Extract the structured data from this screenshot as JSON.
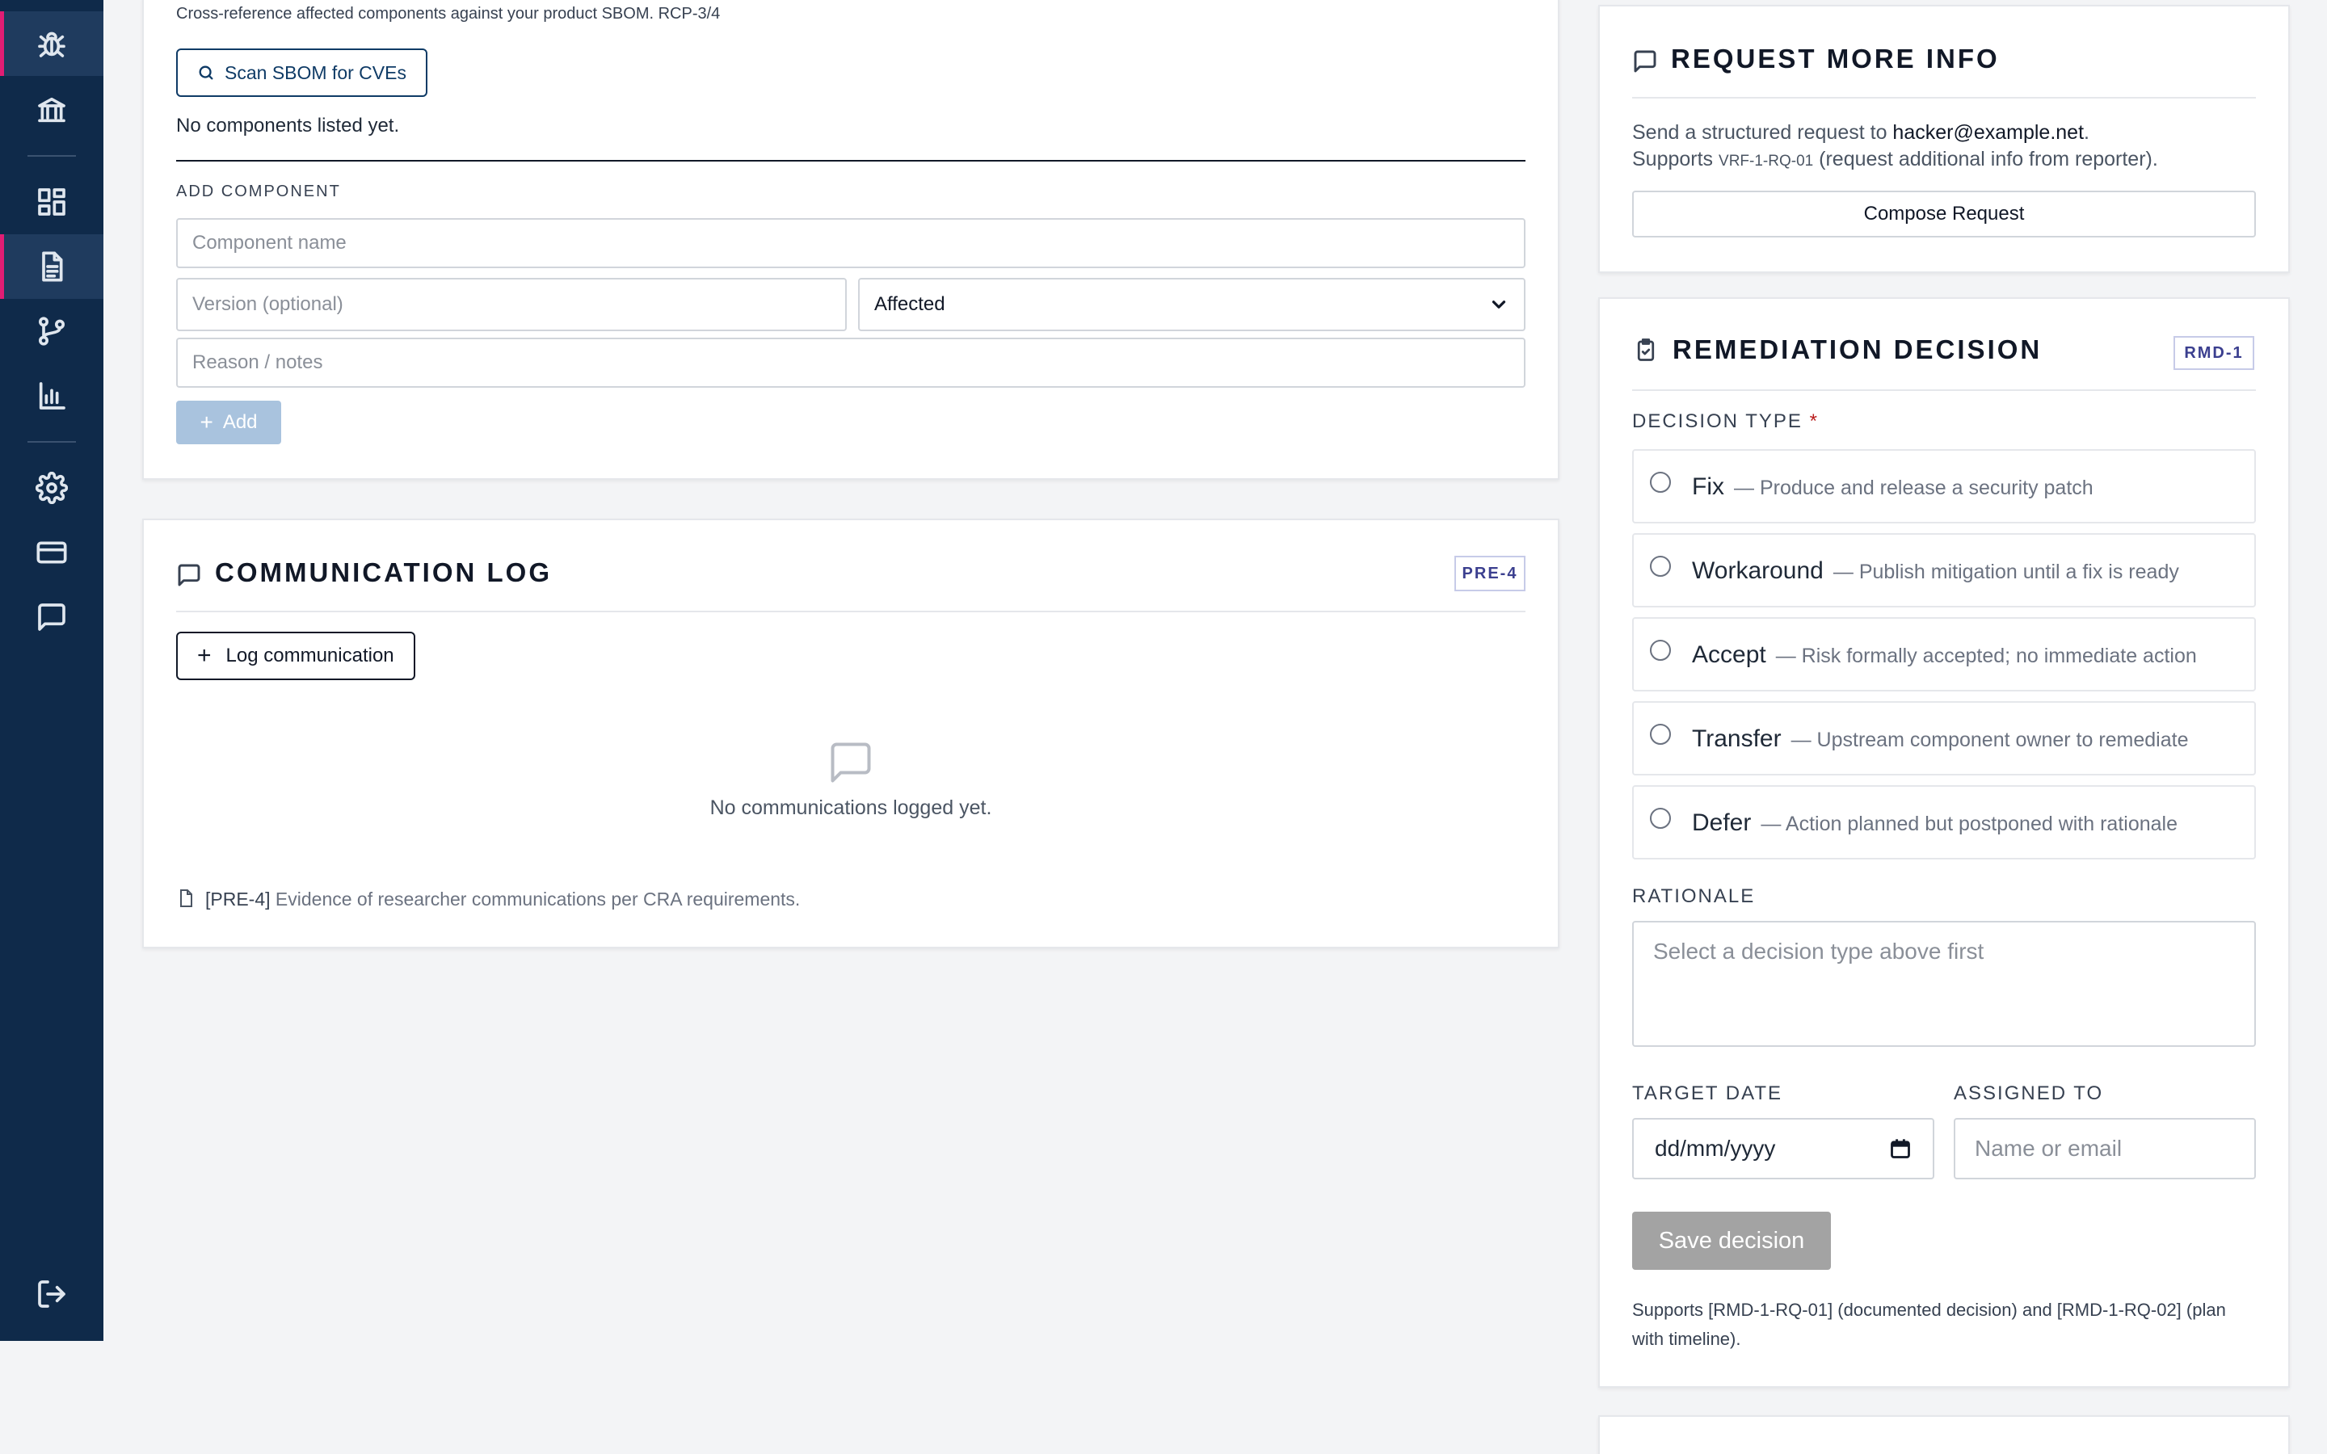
{
  "sidebar": {
    "items": [
      {
        "icon": "bug-icon",
        "active": true
      },
      {
        "icon": "bank-icon"
      },
      {
        "icon": "dashboard-icon"
      },
      {
        "icon": "document-icon",
        "active": true
      },
      {
        "icon": "branch-icon"
      },
      {
        "icon": "bar-chart-icon"
      },
      {
        "icon": "gear-icon"
      },
      {
        "icon": "credit-card-icon"
      },
      {
        "icon": "chat-icon"
      },
      {
        "icon": "logout-icon"
      }
    ]
  },
  "components": {
    "hint": "Cross-reference affected components against your product SBOM. RCP-3/4",
    "scan_label": "Scan SBOM for CVEs",
    "empty_text": "No components listed yet.",
    "add_heading": "ADD COMPONENT",
    "name_placeholder": "Component name",
    "version_placeholder": "Version (optional)",
    "status_value": "Affected",
    "reason_placeholder": "Reason / notes",
    "add_label": "Add"
  },
  "communication": {
    "title": "COMMUNICATION LOG",
    "badge": "PRE-4",
    "log_label": "Log communication",
    "empty_text": "No communications logged yet.",
    "footnote_ref": "[PRE-4]",
    "footnote": "Evidence of researcher communications per CRA requirements."
  },
  "request_info": {
    "title": "REQUEST MORE INFO",
    "desc_prefix": "Send a structured request to",
    "email": "hacker@example.net",
    "desc_suffix": ".",
    "supports_prefix": "Supports",
    "supports_code": "VRF-1-RQ-01",
    "supports_suffix": "(request additional info from reporter).",
    "compose_label": "Compose Request"
  },
  "remediation": {
    "title": "REMEDIATION DECISION",
    "badge": "RMD-1",
    "decision_type_label": "DECISION TYPE",
    "required_mark": "*",
    "options": [
      {
        "label": "Fix",
        "desc": "— Produce and release a security patch"
      },
      {
        "label": "Workaround",
        "desc": "— Publish mitigation until a fix is ready"
      },
      {
        "label": "Accept",
        "desc": "— Risk formally accepted; no immediate action"
      },
      {
        "label": "Transfer",
        "desc": "— Upstream component owner to remediate"
      },
      {
        "label": "Defer",
        "desc": "— Action planned but postponed with rationale"
      }
    ],
    "rationale_label": "RATIONALE",
    "rationale_placeholder": "Select a decision type above first",
    "target_date_label": "TARGET DATE",
    "target_date_placeholder": "dd/mm/yyyy",
    "assigned_label": "ASSIGNED TO",
    "assigned_placeholder": "Name or email",
    "save_label": "Save decision",
    "supports_note": "Supports [RMD-1-RQ-01] (documented decision) and [RMD-1-RQ-02] (plan with timeline)."
  },
  "colors": {
    "sidebar_bg": "#0f2a4a",
    "accent_pink": "#e11d74",
    "primary_blue": "#0f3b66",
    "disabled_blue": "#a9c3de",
    "disabled_gray": "#a3a3a3",
    "required_red": "#b91c1c"
  }
}
